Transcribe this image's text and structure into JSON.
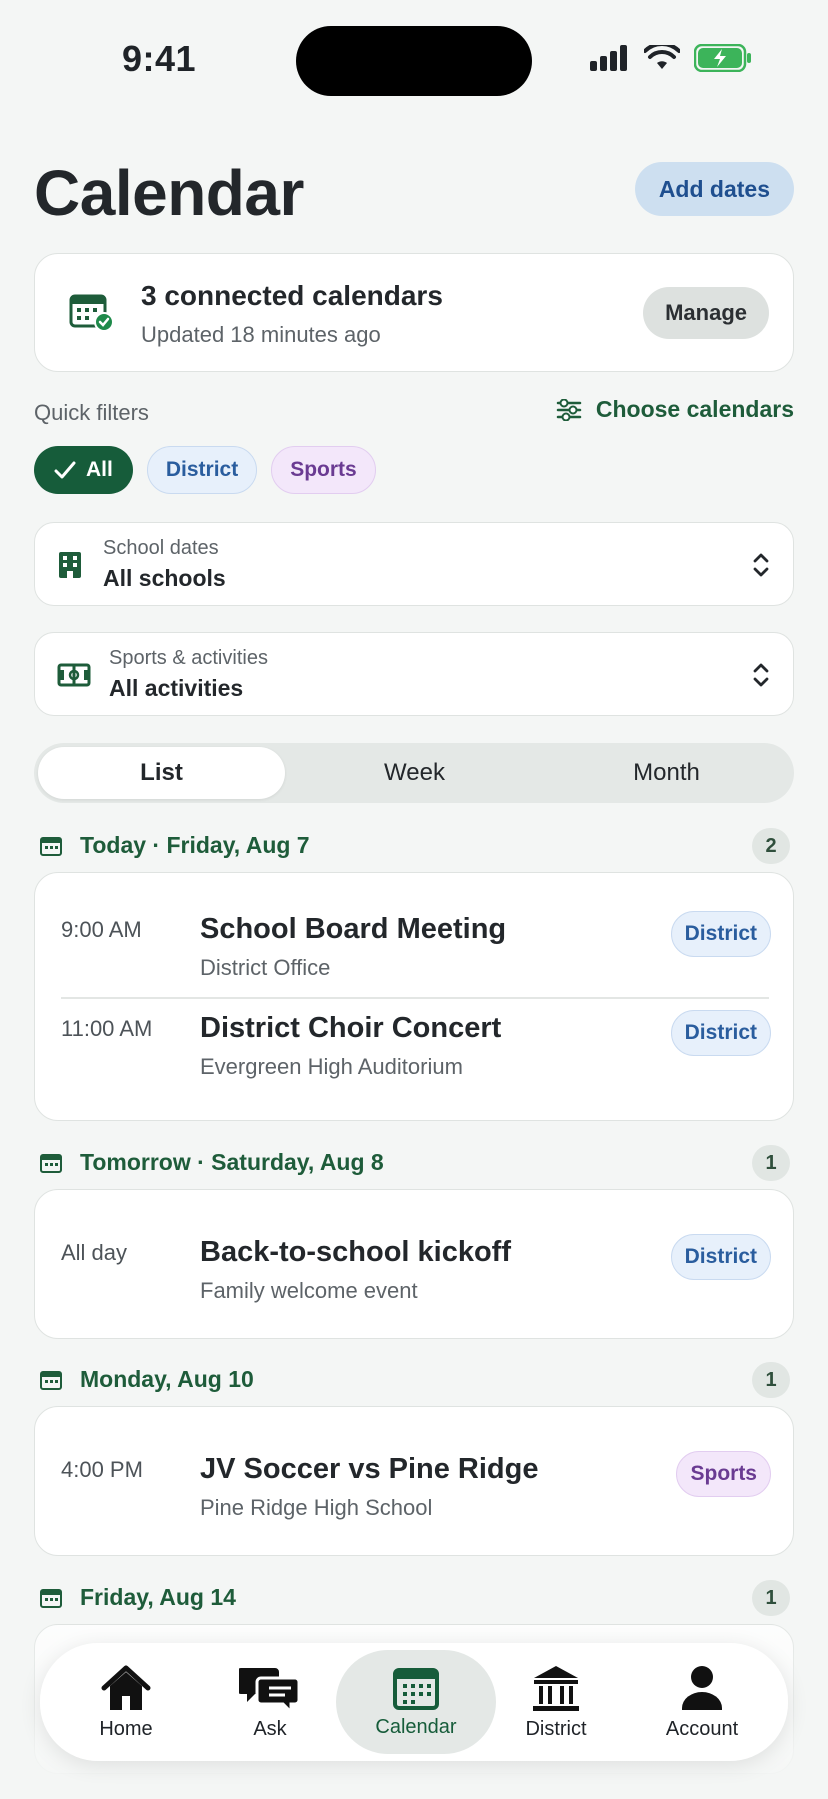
{
  "status": {
    "time": "9:41"
  },
  "header": {
    "title": "Calendar",
    "add_dates": "Add dates"
  },
  "connected": {
    "title": "3 connected calendars",
    "subtitle": "Updated 18 minutes ago",
    "manage": "Manage"
  },
  "filters": {
    "label": "Quick filters",
    "choose": "Choose calendars",
    "chips": [
      "All",
      "District",
      "Sports"
    ]
  },
  "school_select": {
    "label": "School dates",
    "value": "All schools"
  },
  "activity_select": {
    "label": "Sports & activities",
    "value": "All activities"
  },
  "view_tabs": [
    "List",
    "Week",
    "Month"
  ],
  "days": [
    {
      "label": "Today · Friday, Aug 7",
      "count": "2",
      "events": [
        {
          "time": "9:00 AM",
          "title": "School Board Meeting",
          "location": "District Office",
          "tag": "District"
        },
        {
          "time": "11:00 AM",
          "title": "District Choir Concert",
          "location": "Evergreen High Auditorium",
          "tag": "District"
        }
      ]
    },
    {
      "label": "Tomorrow · Saturday, Aug 8",
      "count": "1",
      "events": [
        {
          "time": "All day",
          "title": "Back-to-school kickoff",
          "location": "Family welcome event",
          "tag": "District"
        }
      ]
    },
    {
      "label": "Monday, Aug 10",
      "count": "1",
      "events": [
        {
          "time": "4:00 PM",
          "title": "JV Soccer vs Pine Ridge",
          "location": "Pine Ridge High School",
          "tag": "Sports"
        }
      ]
    },
    {
      "label": "Friday, Aug 14",
      "count": "1",
      "events": []
    }
  ],
  "tabbar": [
    "Home",
    "Ask",
    "Calendar",
    "District",
    "Account"
  ],
  "colors": {
    "accent": "#165c3a",
    "district": "#2a5d9e",
    "sports": "#6a3b92"
  }
}
